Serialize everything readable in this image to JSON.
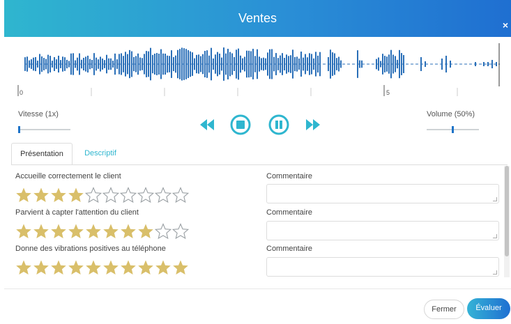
{
  "dialog": {
    "title": "Ventes",
    "close_icon": "×"
  },
  "timeline": {
    "tick_start": "0",
    "tick_mid": "5"
  },
  "controls": {
    "speed_label": "Vitesse (1x)",
    "volume_label": "Volume (50%)",
    "speed_level": 0.0,
    "volume_level": 0.5
  },
  "media": {
    "rewind_icon": "rewind-icon",
    "stop_icon": "stop-icon",
    "pause_icon": "pause-icon",
    "forward_icon": "fast-forward-icon",
    "accent": "#2fb6cf"
  },
  "tabs": [
    {
      "label": "Présentation",
      "active": true
    },
    {
      "label": "Descriptif",
      "active": false
    }
  ],
  "criteria": [
    {
      "label": "Accueille correctement le client",
      "rating": 4,
      "max": 10,
      "comment_label": "Commentaire",
      "comment": ""
    },
    {
      "label": "Parvient à capter l'attention du client",
      "rating": 8,
      "max": 10,
      "comment_label": "Commentaire",
      "comment": ""
    },
    {
      "label": "Donne des vibrations positives au téléphone",
      "rating": 10,
      "max": 10,
      "comment_label": "Commentaire",
      "comment": ""
    }
  ],
  "footer": {
    "close_label": "Fermer",
    "evaluate_label": "Évaluer"
  },
  "colors": {
    "star_filled": "#d9bf6a",
    "star_empty": "#9aa0a4",
    "wave": "#2a6fb8"
  }
}
